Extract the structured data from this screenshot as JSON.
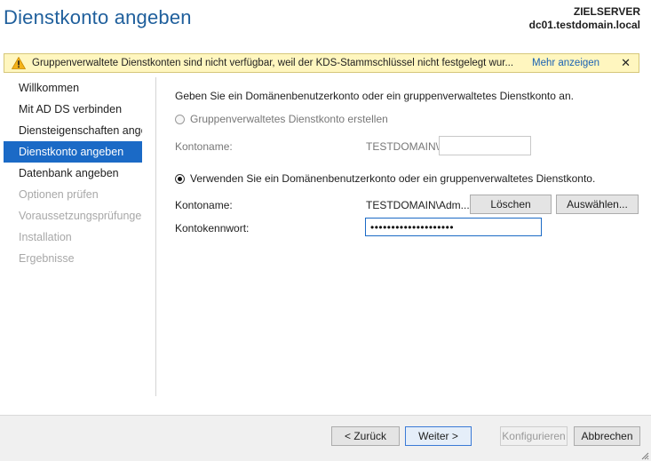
{
  "header": {
    "title": "Dienstkonto angeben",
    "server_label": "ZIELSERVER",
    "server_name": "dc01.testdomain.local"
  },
  "warning": {
    "text": "Gruppenverwaltete Dienstkonten sind nicht verfügbar, weil der KDS-Stammschlüssel nicht festgelegt wur...",
    "link": "Mehr anzeigen",
    "close": "✕",
    "icon": "warning-icon"
  },
  "nav": {
    "items": [
      {
        "label": "Willkommen",
        "state": "normal"
      },
      {
        "label": "Mit AD DS verbinden",
        "state": "normal"
      },
      {
        "label": "Diensteigenschaften ange...",
        "state": "normal"
      },
      {
        "label": "Dienstkonto angeben",
        "state": "active"
      },
      {
        "label": "Datenbank angeben",
        "state": "normal"
      },
      {
        "label": "Optionen prüfen",
        "state": "disabled"
      },
      {
        "label": "Voraussetzungsprüfungen",
        "state": "disabled"
      },
      {
        "label": "Installation",
        "state": "disabled"
      },
      {
        "label": "Ergebnisse",
        "state": "disabled"
      }
    ]
  },
  "main": {
    "intro": "Geben Sie ein Domänenbenutzerkonto oder ein gruppenverwaltetes Dienstkonto an.",
    "option_gmsa": {
      "label": "Gruppenverwaltetes Dienstkonto erstellen",
      "checked": false,
      "account_label": "Kontoname:",
      "domain_prefix": "TESTDOMAIN\\",
      "account_value": ""
    },
    "option_user": {
      "label": "Verwenden Sie ein Domänenbenutzerkonto oder ein gruppenverwaltetes Dienstkonto.",
      "checked": true,
      "account_label": "Kontoname:",
      "account_value": "TESTDOMAIN\\Adm...",
      "clear_button": "Löschen",
      "select_button": "Auswählen...",
      "password_label": "Kontokennwort:",
      "password_mask": "••••••••••••••••••••"
    }
  },
  "footer": {
    "back": "< Zurück",
    "next": "Weiter >",
    "configure": "Konfigurieren",
    "cancel": "Abbrechen"
  },
  "colors": {
    "title": "#1f5f9c",
    "nav_active": "#1b6ac6",
    "warning_bg": "#fff6bf",
    "link": "#1a62b3"
  }
}
